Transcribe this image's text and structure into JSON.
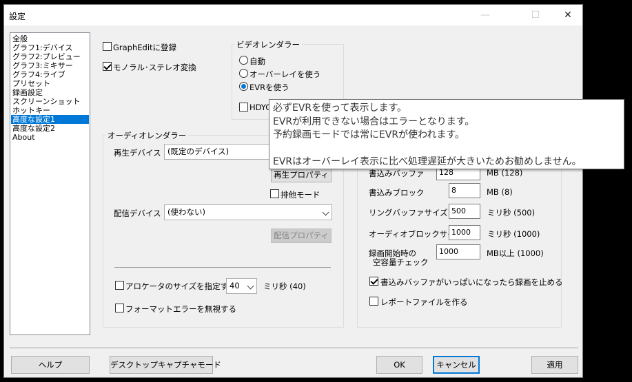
{
  "window": {
    "title": "設定",
    "minimize": "—",
    "maximize": "☐",
    "close": "✕"
  },
  "sidebar": {
    "items": [
      "全般",
      "グラフ1:デバイス",
      "グラフ2:プレビュー",
      "グラフ3:ミキサー",
      "グラフ4:ライブ",
      "プリセット",
      "録画設定",
      "スクリーンショット",
      "ホットキー",
      "高度な設定1",
      "高度な設定2",
      "About"
    ],
    "selected_index": 9
  },
  "left": {
    "graphedit": {
      "label": "GraphEditに登録",
      "checked": false
    },
    "mono_stereo": {
      "label": "モノラル･ステレオ変換",
      "checked": true
    }
  },
  "video_renderer": {
    "title": "ビデオレンダラー",
    "options": [
      "自動",
      "オーバーレイを使う",
      "EVRを使う"
    ],
    "selected_index": 2,
    "hdycti": {
      "label": "HDYCT",
      "checked": false
    }
  },
  "audio_renderer": {
    "title": "オーディオレンダラー",
    "playback_device_label": "再生デバイス",
    "playback_device_value": "(既定のデバイス)",
    "playback_props_button": "再生プロパティ",
    "exclusive_mode": {
      "label": "排他モード",
      "checked": false
    },
    "stream_device_label": "配信デバイス",
    "stream_device_value": "(使わない)",
    "stream_props_button": "配信プロパティ",
    "allocator": {
      "label": "アロケータのサイズを指定する",
      "checked": false,
      "value": "40",
      "unit": "ミリ秒 (40)"
    },
    "ignore_format": {
      "label": "フォーマットエラーを無視する",
      "checked": false
    }
  },
  "recording": {
    "buffer_label": "書込みバッファ",
    "buffer_value": "128",
    "buffer_unit": "MB (128)",
    "block_label": "書込みブロック",
    "block_value": "8",
    "block_unit": "MB (8)",
    "ring_label": "リングバッファサイズ",
    "ring_value": "500",
    "ring_unit": "ミリ秒 (500)",
    "audio_block_label": "オーディオブロックサイズ",
    "audio_block_value": "1000",
    "audio_block_unit": "ミリ秒 (1000)",
    "free_space_label_1": "録画開始時の",
    "free_space_label_2": "空容量チェック",
    "free_space_value": "1000",
    "free_space_unit": "MB以上 (1000)",
    "stop_on_full": {
      "label": "書込みバッファがいっぱいになったら録画を止める",
      "checked": true
    },
    "report_file": {
      "label": "レポートファイルを作る",
      "checked": false
    }
  },
  "tooltip": {
    "lines": [
      "必ずEVRを使って表示します。",
      "EVRが利用できない場合はエラーとなります。",
      "予約録画モードでは常にEVRが使われます。",
      "",
      "EVRはオーバーレイ表示に比べ処理遅延が大きいためお勧めしません。"
    ]
  },
  "footer": {
    "help": "ヘルプ",
    "desktop_capture": "デスクトップキャプチャモード",
    "ok": "OK",
    "cancel": "キャンセル",
    "apply": "適用"
  }
}
